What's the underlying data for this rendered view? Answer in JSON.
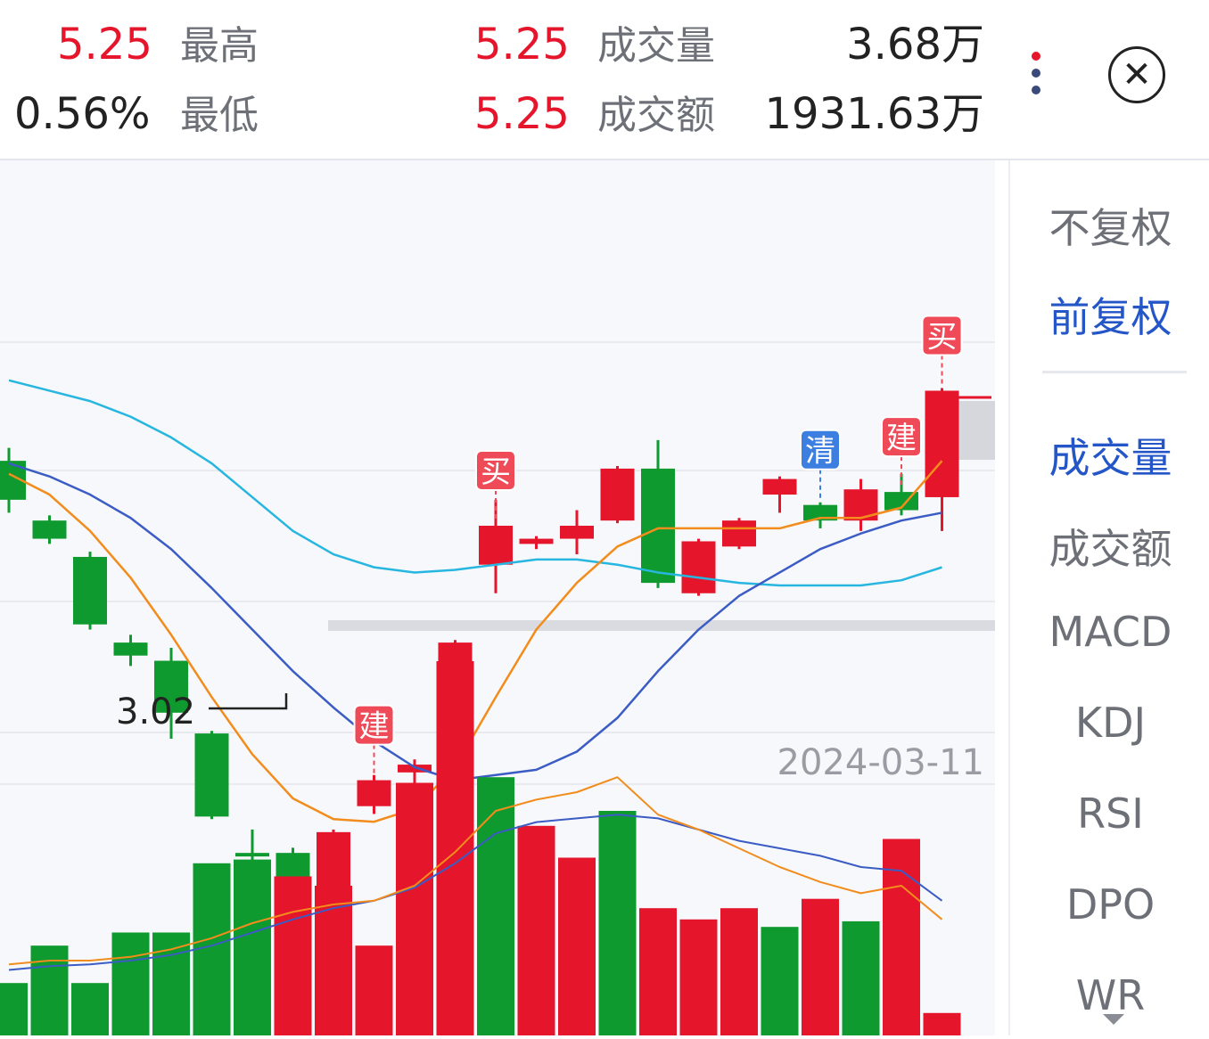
{
  "header": {
    "price": "5.25",
    "change_pct": "0.56%",
    "high_label": "最高",
    "low_label": "最低",
    "high_value": "5.25",
    "low_value": "5.25",
    "volume_label": "成交量",
    "amount_label": "成交额",
    "volume_value": "3.68万",
    "amount_value": "1931.63万",
    "colors": {
      "up": "#e5152b",
      "text": "#222222",
      "label": "#6e7078"
    }
  },
  "menu_icon": "more-vertical-icon",
  "close_icon": "close-circle-icon",
  "sidebar": {
    "adjust_items": [
      {
        "label": "不复权",
        "active": false
      },
      {
        "label": "前复权",
        "active": true
      }
    ],
    "indicator_items": [
      {
        "label": "成交量",
        "active": true
      },
      {
        "label": "成交额",
        "active": false
      },
      {
        "label": "MACD",
        "active": false
      },
      {
        "label": "KDJ",
        "active": false
      },
      {
        "label": "RSI",
        "active": false
      },
      {
        "label": "DPO",
        "active": false
      },
      {
        "label": "WR",
        "active": false
      }
    ],
    "accent": "#2456c8"
  },
  "chart": {
    "date_label": "2024-03-11",
    "min_price_label": "3.02",
    "colors": {
      "up": "#e5152b",
      "down": "#0f9a2f",
      "ma_orange": "#f28c1c",
      "ma_blue": "#3b5cc4",
      "ma_cyan": "#27b6e0"
    }
  },
  "chart_data": {
    "type": "candlestick",
    "min_price": 3.02,
    "candles": [
      {
        "dir": "down",
        "o": 4.25,
        "c": 4.1,
        "h": 4.3,
        "l": 4.05
      },
      {
        "dir": "down",
        "o": 4.02,
        "c": 3.95,
        "h": 4.04,
        "l": 3.93
      },
      {
        "dir": "down",
        "o": 3.88,
        "c": 3.62,
        "h": 3.9,
        "l": 3.6
      },
      {
        "dir": "down",
        "o": 3.55,
        "c": 3.5,
        "h": 3.58,
        "l": 3.46
      },
      {
        "dir": "down",
        "o": 3.48,
        "c": 3.28,
        "h": 3.53,
        "l": 3.18
      },
      {
        "dir": "down",
        "o": 3.2,
        "c": 2.88,
        "h": 3.21,
        "l": 2.87
      },
      {
        "dir": "down",
        "o": 2.74,
        "c": 2.73,
        "h": 2.83,
        "l": 2.66
      },
      {
        "dir": "down",
        "o": 2.74,
        "c": 2.58,
        "h": 2.76,
        "l": 2.48
      },
      {
        "dir": "up",
        "o": 2.58,
        "c": 2.82,
        "h": 2.83,
        "l": 2.57
      },
      {
        "dir": "up",
        "o": 2.92,
        "c": 3.02,
        "h": 3.04,
        "l": 2.89
      },
      {
        "dir": "up",
        "o": 3.05,
        "c": 3.08,
        "h": 3.1,
        "l": 2.98
      },
      {
        "dir": "up",
        "o": 3.08,
        "c": 3.55,
        "h": 3.56,
        "l": 3.07
      },
      {
        "dir": "up",
        "o": 3.85,
        "c": 4.0,
        "h": 4.1,
        "l": 3.74
      },
      {
        "dir": "up",
        "o": 3.93,
        "c": 3.95,
        "h": 3.96,
        "l": 3.91
      },
      {
        "dir": "up",
        "o": 3.95,
        "c": 4.0,
        "h": 4.06,
        "l": 3.89
      },
      {
        "dir": "up",
        "o": 4.02,
        "c": 4.22,
        "h": 4.23,
        "l": 4.01
      },
      {
        "dir": "down",
        "o": 4.22,
        "c": 3.78,
        "h": 4.33,
        "l": 3.76
      },
      {
        "dir": "up",
        "o": 3.74,
        "c": 3.94,
        "h": 3.95,
        "l": 3.73
      },
      {
        "dir": "up",
        "o": 3.92,
        "c": 4.02,
        "h": 4.03,
        "l": 3.91
      },
      {
        "dir": "up",
        "o": 4.12,
        "c": 4.18,
        "h": 4.19,
        "l": 4.05
      },
      {
        "dir": "down",
        "o": 4.08,
        "c": 4.02,
        "h": 4.09,
        "l": 3.99
      },
      {
        "dir": "up",
        "o": 4.02,
        "c": 4.14,
        "h": 4.18,
        "l": 3.98
      },
      {
        "dir": "down",
        "o": 4.13,
        "c": 4.06,
        "h": 4.2,
        "l": 4.04
      },
      {
        "dir": "up",
        "o": 4.11,
        "c": 4.52,
        "h": 4.53,
        "l": 3.98
      }
    ],
    "markers": [
      {
        "candle": 9,
        "label": "建",
        "kind": "build"
      },
      {
        "candle": 12,
        "label": "买",
        "kind": "buy"
      },
      {
        "candle": 20,
        "label": "清",
        "kind": "clear"
      },
      {
        "candle": 22,
        "label": "建",
        "kind": "build"
      },
      {
        "candle": 23,
        "label": "买",
        "kind": "buy"
      }
    ],
    "ma_orange": [
      4.2,
      4.12,
      3.98,
      3.8,
      3.58,
      3.34,
      3.12,
      2.95,
      2.87,
      2.86,
      2.91,
      3.07,
      3.34,
      3.6,
      3.78,
      3.92,
      3.99,
      3.99,
      3.99,
      3.99,
      4.03,
      4.03,
      4.07,
      4.25
    ],
    "ma_blue": [
      4.24,
      4.19,
      4.12,
      4.03,
      3.91,
      3.76,
      3.6,
      3.44,
      3.3,
      3.17,
      3.07,
      3.02,
      3.04,
      3.06,
      3.13,
      3.26,
      3.44,
      3.6,
      3.73,
      3.82,
      3.91,
      3.97,
      4.02,
      4.05
    ],
    "ma_cyan": [
      4.56,
      4.52,
      4.48,
      4.42,
      4.34,
      4.24,
      4.11,
      3.98,
      3.89,
      3.84,
      3.82,
      3.83,
      3.85,
      3.87,
      3.87,
      3.85,
      3.82,
      3.8,
      3.78,
      3.77,
      3.77,
      3.77,
      3.79,
      3.84
    ],
    "volumes": [
      {
        "dir": "down",
        "v": 28
      },
      {
        "dir": "down",
        "v": 48
      },
      {
        "dir": "down",
        "v": 28
      },
      {
        "dir": "down",
        "v": 55
      },
      {
        "dir": "down",
        "v": 55
      },
      {
        "dir": "down",
        "v": 92
      },
      {
        "dir": "down",
        "v": 94
      },
      {
        "dir": "up",
        "v": 85
      },
      {
        "dir": "up",
        "v": 80
      },
      {
        "dir": "up",
        "v": 48
      },
      {
        "dir": "up",
        "v": 135
      },
      {
        "dir": "up",
        "v": 200
      },
      {
        "dir": "down",
        "v": 138
      },
      {
        "dir": "up",
        "v": 112
      },
      {
        "dir": "up",
        "v": 95
      },
      {
        "dir": "down",
        "v": 120
      },
      {
        "dir": "up",
        "v": 68
      },
      {
        "dir": "up",
        "v": 62
      },
      {
        "dir": "up",
        "v": 68
      },
      {
        "dir": "down",
        "v": 58
      },
      {
        "dir": "up",
        "v": 73
      },
      {
        "dir": "down",
        "v": 61
      },
      {
        "dir": "up",
        "v": 105
      },
      {
        "dir": "up",
        "v": 12
      }
    ],
    "vol_ma_orange": [
      38,
      40,
      40,
      42,
      46,
      52,
      60,
      66,
      70,
      72,
      80,
      98,
      120,
      126,
      130,
      138,
      118,
      110,
      100,
      90,
      82,
      76,
      80,
      62
    ],
    "vol_ma_blue": [
      35,
      37,
      38,
      40,
      43,
      48,
      55,
      62,
      68,
      72,
      79,
      92,
      108,
      114,
      116,
      118,
      116,
      110,
      104,
      100,
      96,
      90,
      88,
      72
    ]
  }
}
